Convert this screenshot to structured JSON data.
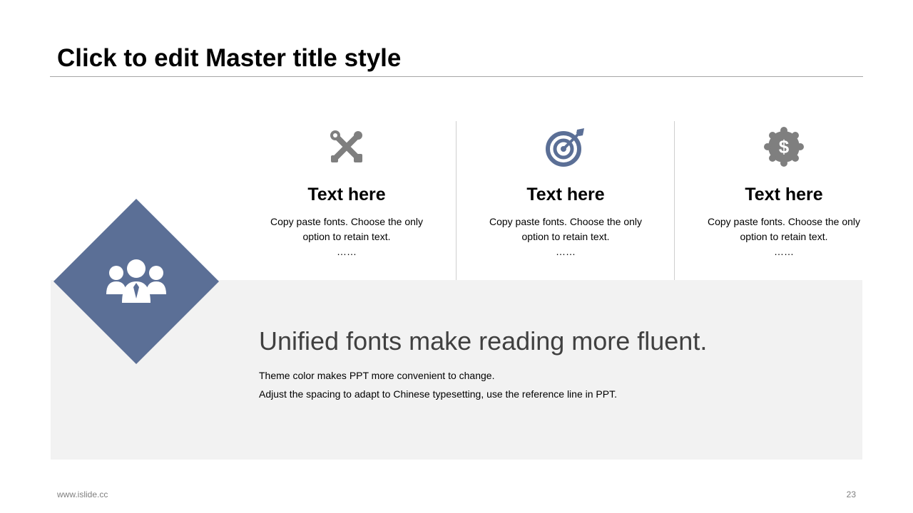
{
  "slide": {
    "title": "Click to edit Master title style",
    "page_number": "23",
    "footer_url": "www.islide.cc"
  },
  "colors": {
    "accent": "#5b6f96",
    "icon_gray": "#7f7f7f",
    "band": "#f2f2f2",
    "divider": "#cfcfcf"
  },
  "hero": {
    "icon": "team-people-icon"
  },
  "columns": [
    {
      "icon": "tools-wrench-hammer-icon",
      "heading": "Text here",
      "body": "Copy paste fonts. Choose the only option to retain text.",
      "dots": "……"
    },
    {
      "icon": "target-icon",
      "heading": "Text here",
      "body": "Copy paste fonts. Choose the only option to retain text.",
      "dots": "……"
    },
    {
      "icon": "dollar-badge-icon",
      "heading": "Text here",
      "body": "Copy paste fonts. Choose the only option to retain text.",
      "dots": "……"
    }
  ],
  "band": {
    "headline": "Unified fonts make reading more fluent.",
    "line1": "Theme color makes PPT more convenient to change.",
    "line2": "Adjust the spacing to adapt to Chinese typesetting, use the reference line in PPT."
  }
}
